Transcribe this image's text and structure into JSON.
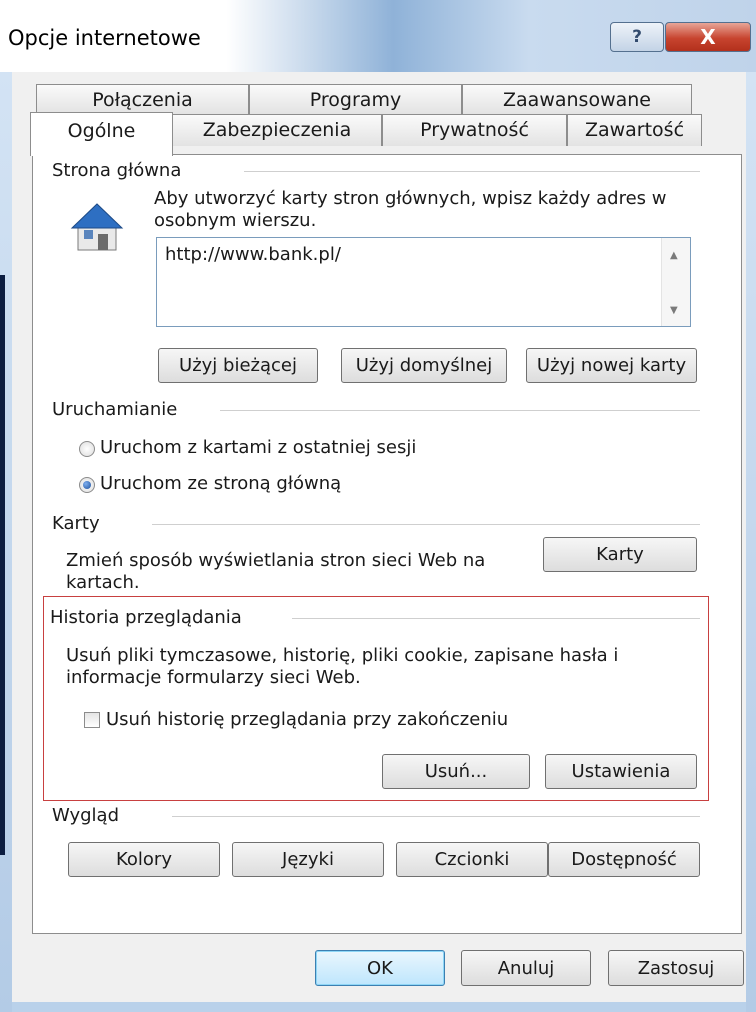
{
  "window": {
    "title": "Opcje internetowe",
    "help_glyph": "?",
    "close_glyph": "X"
  },
  "tabs_row1": [
    "Połączenia",
    "Programy",
    "Zaawansowane"
  ],
  "tabs_row2": [
    "Ogólne",
    "Zabezpieczenia",
    "Prywatność",
    "Zawartość"
  ],
  "home": {
    "heading": "Strona główna",
    "desc_line1": "Aby utworzyć karty stron głównych, wpisz każdy adres w",
    "desc_line2": "osobnym wierszu.",
    "url": "http://www.bank.pl/",
    "btn_current": "Użyj bieżącej",
    "btn_default": "Użyj domyślnej",
    "btn_new_tab": "Użyj nowej karty"
  },
  "startup": {
    "heading": "Uruchamianie",
    "option_last_session": "Uruchom z kartami z ostatniej sesji",
    "option_home": "Uruchom ze stroną główną"
  },
  "tabs_section": {
    "heading": "Karty",
    "desc_line1": "Zmień sposób wyświetlania stron sieci Web na",
    "desc_line2": "kartach.",
    "btn": "Karty"
  },
  "history": {
    "heading": "Historia przeglądania",
    "desc_line1": "Usuń pliki tymczasowe, historię, pliki cookie, zapisane hasła i",
    "desc_line2": "informacje formularzy sieci Web.",
    "checkbox_label": "Usuń historię przeglądania przy zakończeniu",
    "btn_delete": "Usuń...",
    "btn_settings": "Ustawienia"
  },
  "appearance": {
    "heading": "Wygląd",
    "btn_colors": "Kolory",
    "btn_languages": "Języki",
    "btn_fonts": "Czcionki",
    "btn_accessibility": "Dostępność"
  },
  "footer": {
    "ok": "OK",
    "cancel": "Anuluj",
    "apply": "Zastosuj"
  },
  "colors": {
    "highlight_border": "#c84040",
    "default_button": "#bee6fd"
  }
}
